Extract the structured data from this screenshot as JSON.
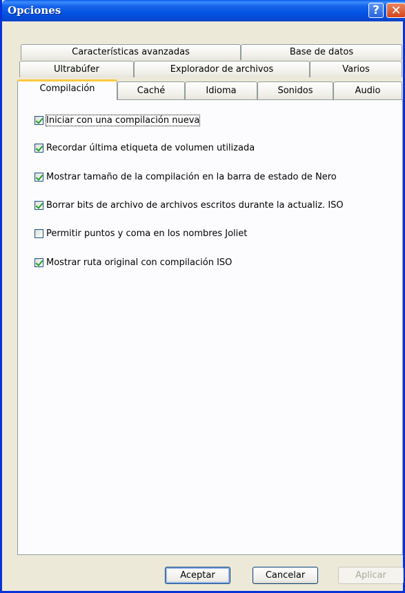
{
  "window": {
    "title": "Opciones",
    "help_glyph": "?",
    "close_glyph": "✕"
  },
  "tabs": {
    "row1": [
      {
        "label": "Características avanzadas"
      },
      {
        "label": "Base de datos"
      }
    ],
    "row2": [
      {
        "label": "Ultrabúfer"
      },
      {
        "label": "Explorador de archivos"
      },
      {
        "label": "Varios"
      }
    ],
    "row3": [
      {
        "label": "Compilación",
        "active": true
      },
      {
        "label": "Caché"
      },
      {
        "label": "Idioma"
      },
      {
        "label": "Sonidos"
      },
      {
        "label": "Audio"
      }
    ]
  },
  "options": [
    {
      "label": "Iniciar con una compilación nueva",
      "checked": true,
      "focused": true
    },
    {
      "label": "Recordar última etiqueta de volumen utilizada",
      "checked": true
    },
    {
      "label": "Mostrar tamaño de la compilación en la barra de estado de Nero",
      "checked": true
    },
    {
      "label": "Borrar bits de archivo de archivos escritos durante la actualiz. ISO",
      "checked": true
    },
    {
      "label": "Permitir puntos y coma en los nombres Joliet",
      "checked": false
    },
    {
      "label": "Mostrar ruta original con compilación ISO",
      "checked": true
    }
  ],
  "buttons": {
    "accept": "Aceptar",
    "cancel": "Cancelar",
    "apply": "Aplicar"
  },
  "colors": {
    "titlebar": "#0a5ee8",
    "active_tab_accent": "#ffc83c",
    "checkmark": "#21a121"
  }
}
